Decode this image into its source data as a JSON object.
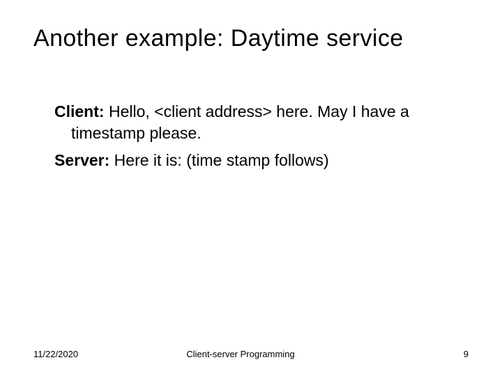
{
  "title": "Another example: Daytime service",
  "body": {
    "client": {
      "label": "Client:",
      "text_line1": " Hello, <client address> here.  May I have a",
      "text_line2": "timestamp please."
    },
    "server": {
      "label": "Server:",
      "text": " Here it is: (time stamp follows)"
    }
  },
  "footer": {
    "date": "11/22/2020",
    "center": "Client-server Programming",
    "page": "9"
  }
}
